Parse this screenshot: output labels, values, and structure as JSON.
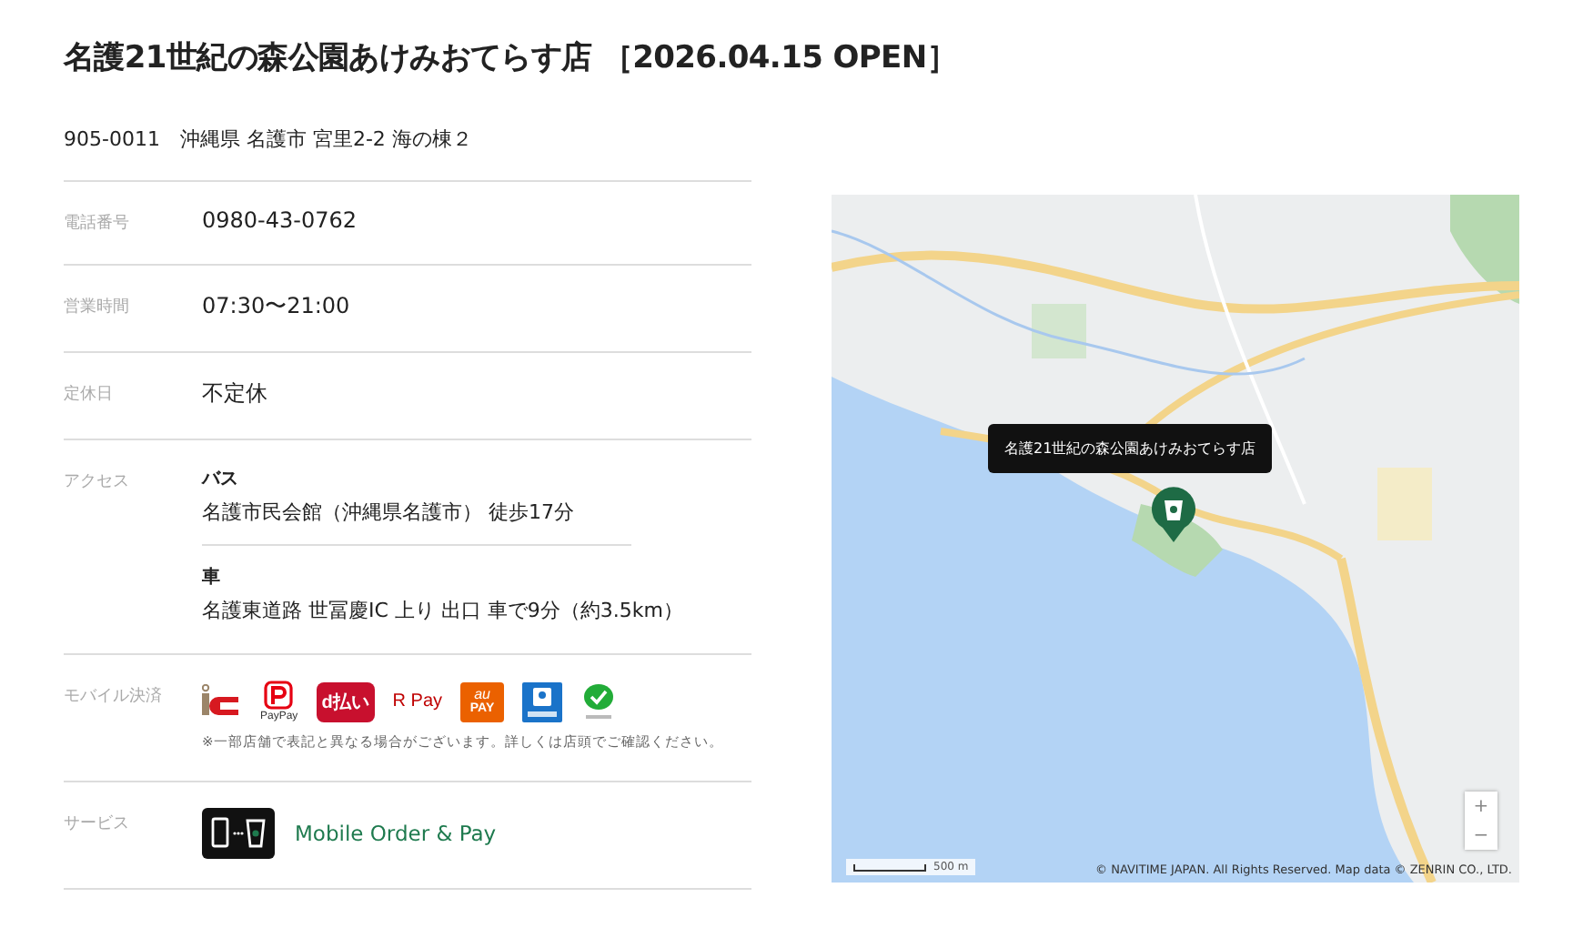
{
  "title": "名護21世紀の森公園あけみおてらす店 ［2026.04.15 OPEN］",
  "address": "905-0011　沖縄県 名護市 宮里2-2 海の棟２",
  "rows": [
    {
      "kind": "text",
      "label": "電話番号",
      "value": "0980-43-0762"
    },
    {
      "kind": "text",
      "label": "営業時間",
      "value": "07:30〜21:00"
    },
    {
      "kind": "text",
      "label": "定休日",
      "value": "不定休"
    },
    {
      "kind": "access",
      "label": "アクセス",
      "routes": [
        {
          "mode": "バス",
          "detail": "名護市民会館（沖縄県名護市） 徒歩17分"
        },
        {
          "mode": "車",
          "detail": "名護東道路 世冨慶IC 上り 出口 車で9分（約3.5km）"
        }
      ]
    },
    {
      "kind": "payments",
      "label": "モバイル決済",
      "methods": [
        {
          "kind": "ic"
        },
        {
          "kind": "paypay",
          "caption": "PayPay"
        },
        {
          "kind": "dpay",
          "caption": "d払い"
        },
        {
          "kind": "rpay",
          "caption": "R Pay"
        },
        {
          "kind": "aupay",
          "caption_top": "au",
          "caption": "PAY"
        },
        {
          "kind": "bluepay"
        },
        {
          "kind": "wechat"
        }
      ],
      "note": "※一部店舗で表記と異なる場合がございます。詳しくは店頭でご確認ください。"
    },
    {
      "kind": "service",
      "label": "サービス",
      "service": "Mobile Order & Pay"
    }
  ],
  "map": {
    "kind": "picture",
    "popup": "名護21世紀の森公園あけみおてらす店",
    "scale": "500 m",
    "attribution": "© NAVITIME JAPAN. All Rights Reserved. Map data © ZENRIN CO., LTD.",
    "zoom_in": "+",
    "zoom_out": "−"
  }
}
